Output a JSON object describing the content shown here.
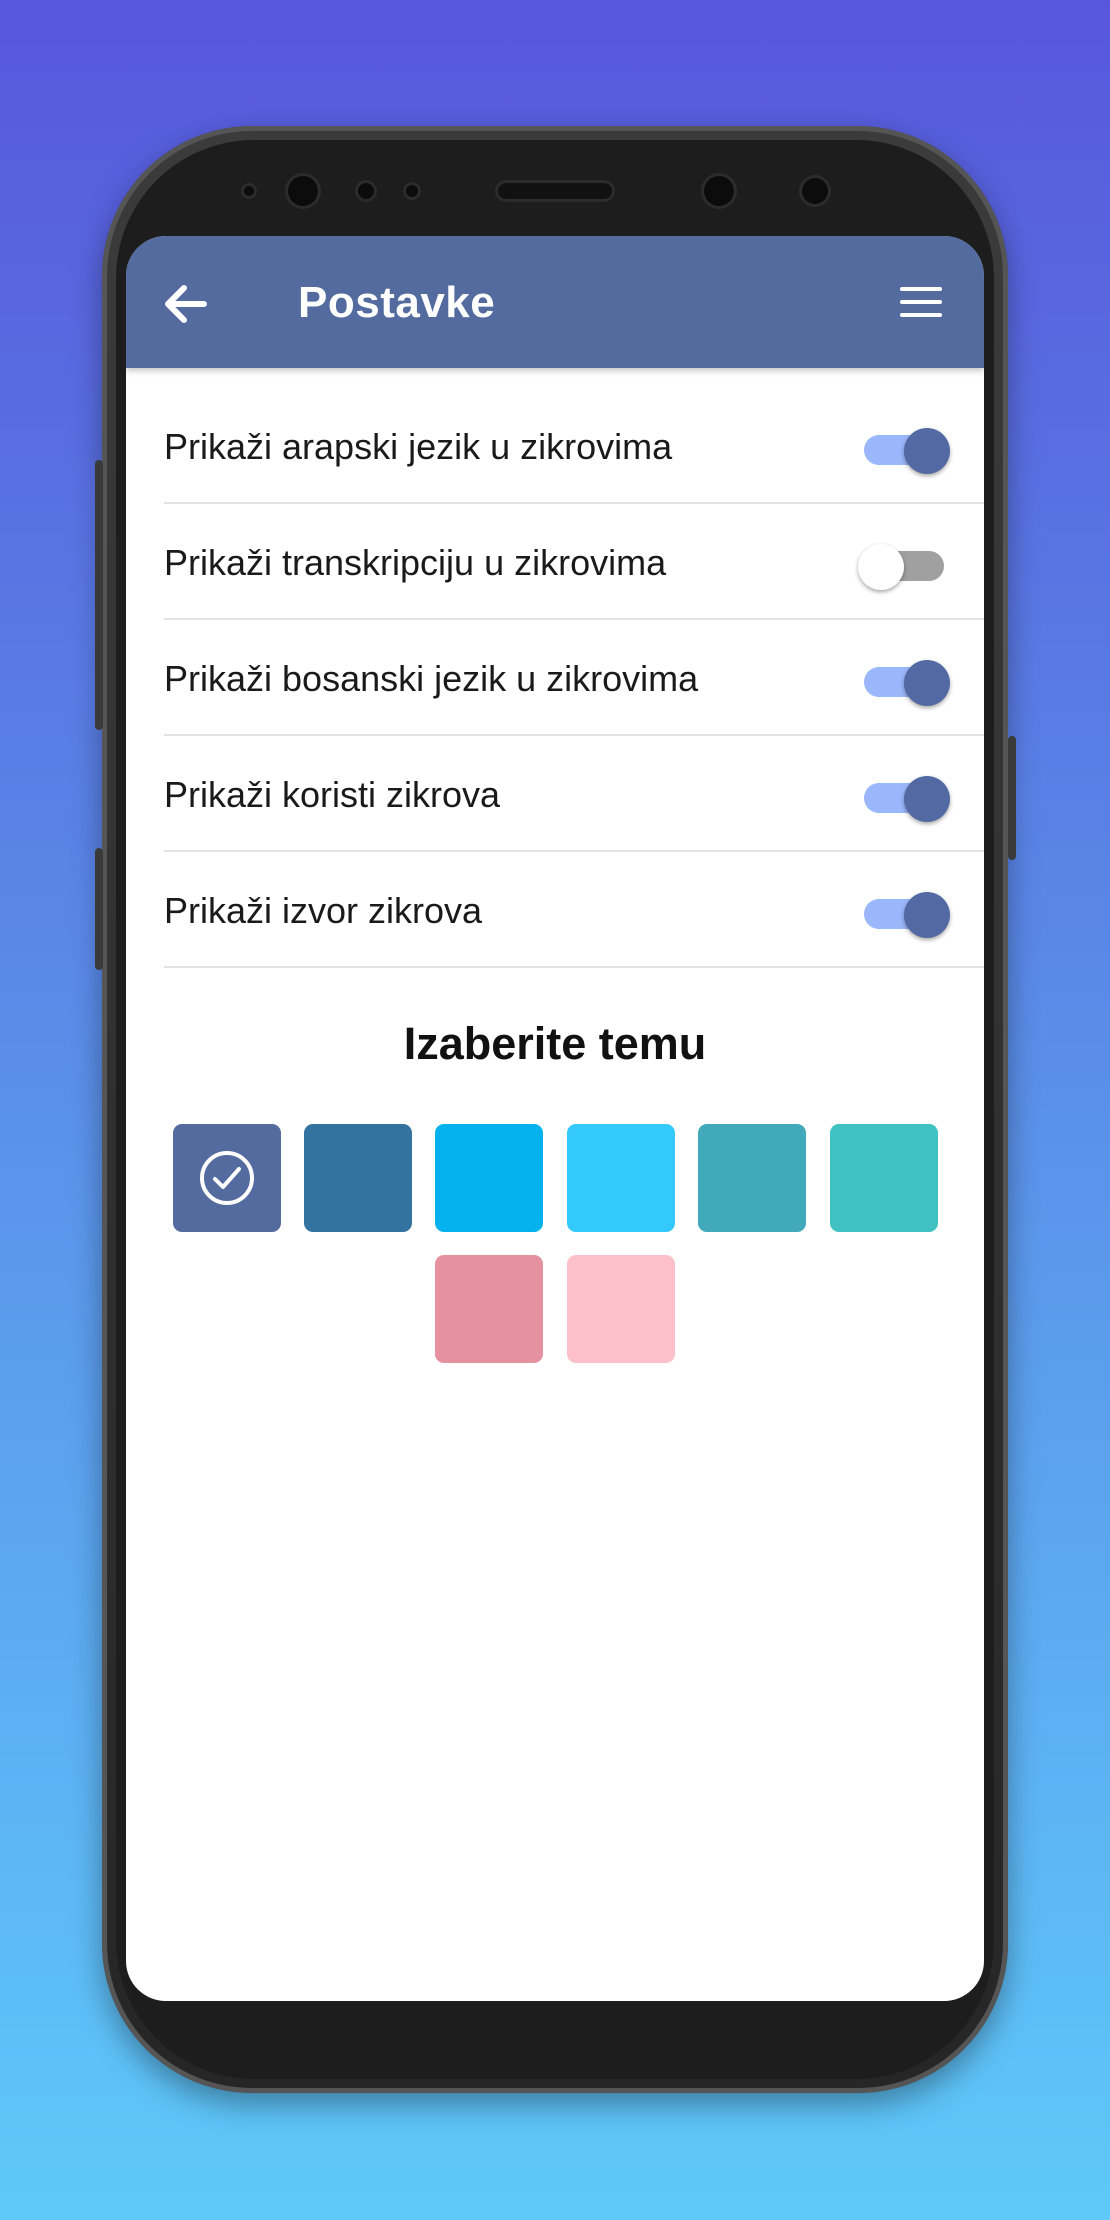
{
  "app": {
    "title": "Postavke"
  },
  "settings": [
    {
      "label": "Prikaži arapski jezik u zikrovima",
      "enabled": true
    },
    {
      "label": "Prikaži transkripciju u zikrovima",
      "enabled": false
    },
    {
      "label": "Prikaži bosanski jezik u zikrovima",
      "enabled": true
    },
    {
      "label": "Prikaži koristi zikrova",
      "enabled": true
    },
    {
      "label": "Prikaži izvor zikrova",
      "enabled": true
    }
  ],
  "theme": {
    "heading": "Izaberite temu",
    "selected_index": 0,
    "colors": [
      "#536b9f",
      "#33739f",
      "#06b2ee",
      "#33c9fc",
      "#42a9ba",
      "#41c2c2",
      "#e5919f",
      "#fec1cb"
    ]
  },
  "icons": {
    "back": "arrow-left-icon",
    "menu": "hamburger-menu-icon",
    "check": "check-circle-icon"
  },
  "colors": {
    "appbar": "#536b9f",
    "toggle_on_track": "#9bb7fb",
    "toggle_on_knob": "#5269a3",
    "toggle_off_track": "#a0a0a0",
    "toggle_off_knob": "#ffffff"
  }
}
